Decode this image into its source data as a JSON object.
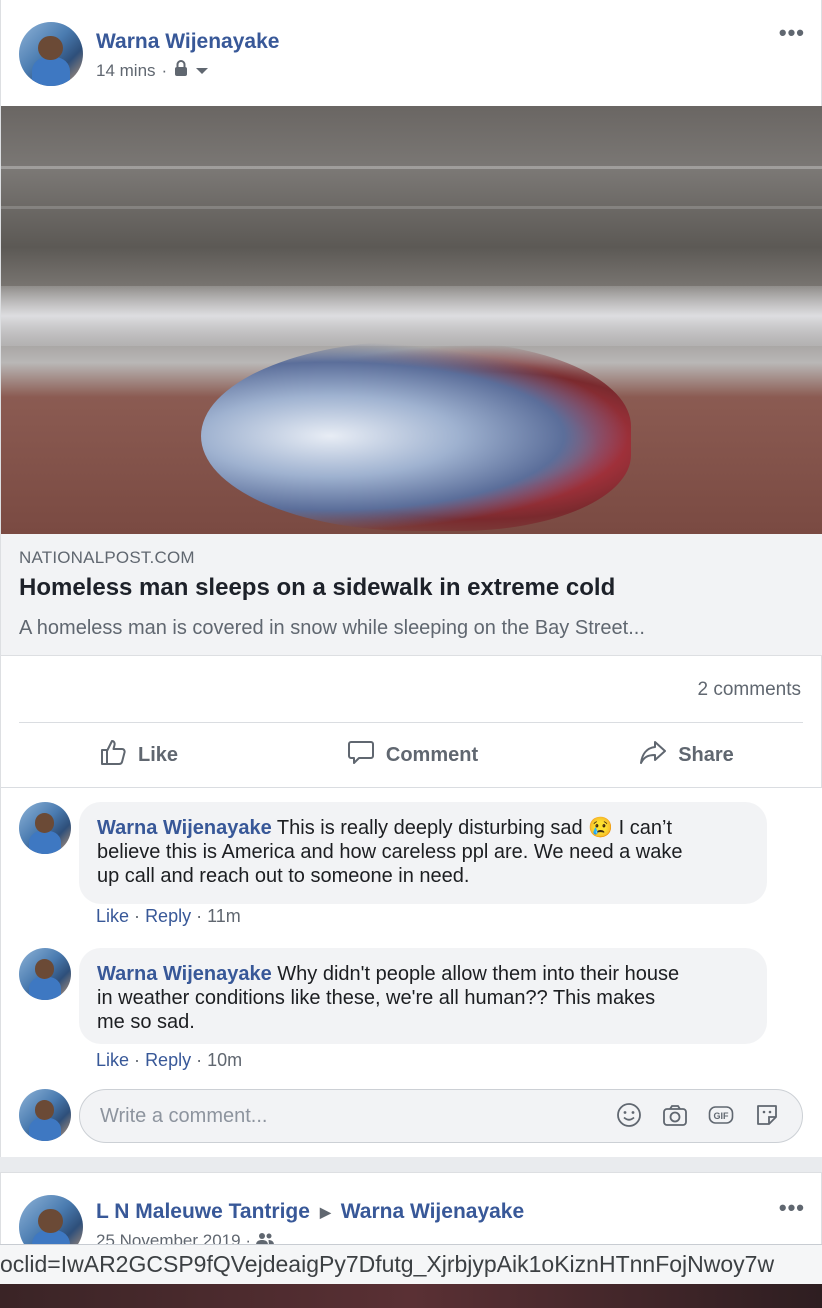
{
  "post": {
    "author": "Warna Wijenayake",
    "time": "14 mins",
    "separator": "·",
    "more": "•••",
    "link": {
      "domain": "NATIONALPOST.COM",
      "title": "Homeless man sleeps on a sidewalk in extreme cold",
      "description": "A homeless man is covered in snow while sleeping on the Bay Street..."
    },
    "comment_count": "2 comments",
    "actions": {
      "like": "Like",
      "comment": "Comment",
      "share": "Share"
    }
  },
  "comments": [
    {
      "author": "Warna Wijenayake",
      "text_before_emoji": "This is really deeply disturbing sad",
      "emoji": "😢",
      "text_line1_end": "I can’t",
      "text_line2": "believe this is America and how careless ppl are. We need a wake",
      "text_line3": "up call and reach out to someone in need.",
      "like": "Like",
      "reply": "Reply",
      "dot": "·",
      "time": "11m"
    },
    {
      "author": "Warna Wijenayake",
      "text_line1": "Why didn't people allow them into their house",
      "text_line2": "in weather conditions like these, we're all human?? This makes",
      "text_line3": "me so sad.",
      "like": "Like",
      "reply": "Reply",
      "dot": "·",
      "time": "10m"
    }
  ],
  "composer": {
    "placeholder": "Write a comment..."
  },
  "next_post": {
    "author": "L N Maleuwe Tantrige",
    "target": "Warna Wijenayake",
    "date": "25 November 2019 ·",
    "more": "•••"
  },
  "status_bar": {
    "url": "oclid=IwAR2GCSP9fQVejdeaigPy7Dfutg_XjrbjypAik1oKiznHTnnFojNwoy7w"
  },
  "colors": {
    "link_blue": "#385898",
    "meta_gray": "#606770",
    "bubble_bg": "#f2f3f5"
  },
  "icons": [
    "lock-icon",
    "audience-dropdown-icon",
    "like-icon",
    "comment-icon",
    "share-icon",
    "emoji-icon",
    "camera-icon",
    "gif-icon",
    "sticker-icon",
    "friends-icon",
    "more-icon"
  ]
}
